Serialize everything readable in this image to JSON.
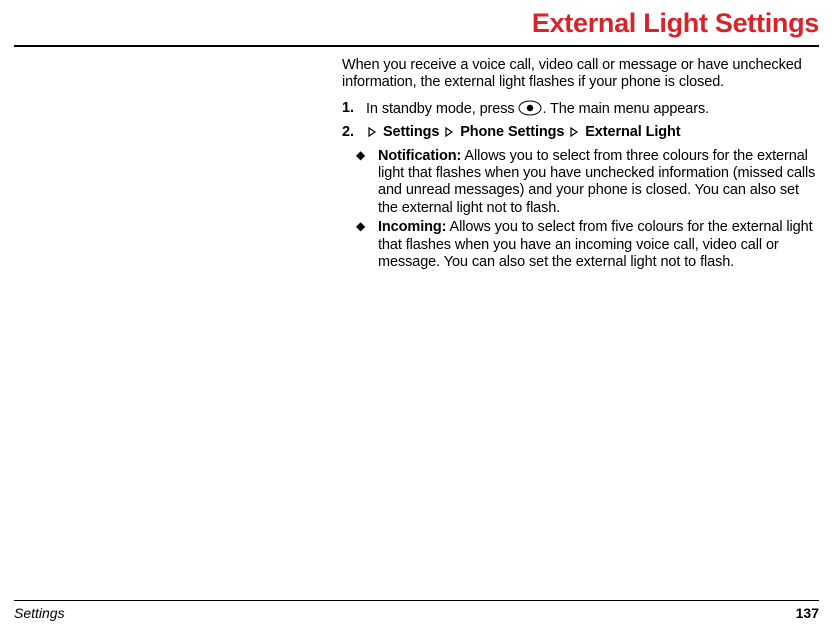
{
  "title": "External Light Settings",
  "intro": "When you receive a voice call, video call or message or have unchecked information, the external light flashes if your phone is closed.",
  "steps": {
    "s1": {
      "num": "1.",
      "before_icon": "In standby mode, press ",
      "after_icon": ". The main menu appears."
    },
    "s2": {
      "num": "2.",
      "path1": "Settings",
      "path2": "Phone Settings",
      "path3": "External Light"
    }
  },
  "sub": {
    "notification": {
      "label": "Notification:",
      "text": " Allows you to select from three colours for the external light that flashes when you have unchecked information (missed calls and unread messages) and your phone is closed. You can also set the external light not to flash."
    },
    "incoming": {
      "label": "Incoming:",
      "text": " Allows you to select from five colours for the external light that flashes when you have an incoming voice call, video call or message. You can also set the external light not to flash."
    }
  },
  "footer": {
    "section": "Settings",
    "page": "137"
  }
}
